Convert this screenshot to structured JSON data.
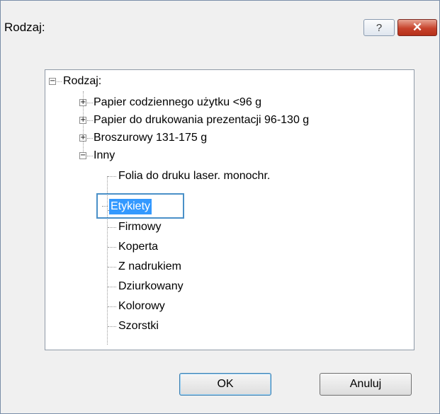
{
  "window": {
    "title": "Rodzaj:",
    "help_label": "?",
    "close_label": "✕"
  },
  "tree": {
    "root": "Rodzaj:",
    "groups": [
      "Papier codziennego użytku <96 g",
      "Papier do drukowania prezentacji 96-130 g",
      "Broszurowy 131-175 g",
      "Inny"
    ],
    "inny_children": [
      "Folia do druku laser. monochr.",
      "Etykiety",
      "Firmowy",
      "Koperta",
      "Z nadrukiem",
      "Dziurkowany",
      "Kolorowy",
      "Szorstki"
    ],
    "selected": "Etykiety",
    "expander_collapsed": "+",
    "expander_expanded": "−"
  },
  "buttons": {
    "ok": "OK",
    "cancel": "Anuluj"
  },
  "colors": {
    "selection": "#3399ff",
    "focus_border": "#4a90c8",
    "close_button": "#c7432c"
  }
}
